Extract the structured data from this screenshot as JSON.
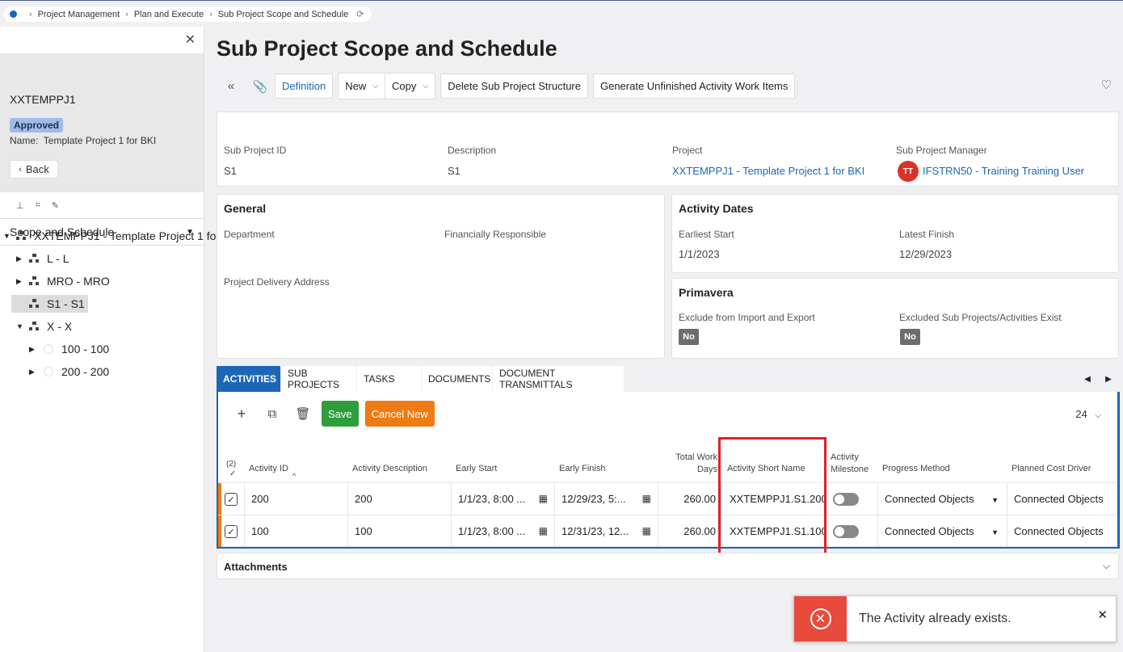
{
  "breadcrumb": {
    "items": [
      "Project Management",
      "Plan and Execute",
      "Sub Project Scope and Schedule"
    ]
  },
  "left": {
    "project_id": "XXTEMPPJ1",
    "status": "Approved",
    "name_label": "Name:",
    "name_value": "Template Project 1 for BKI",
    "back": "Back",
    "scope_select": "Scope and Schedule",
    "tree": [
      "XXTEMPPJ1 - Template Project 1 for",
      "L - L",
      "MRO - MRO",
      "S1 - S1",
      "X - X",
      "100 - 100",
      "200 - 200"
    ]
  },
  "page": {
    "title": "Sub Project Scope and Schedule"
  },
  "toolbar": {
    "definition": "Definition",
    "new": "New",
    "copy": "Copy",
    "delete_structure": "Delete Sub Project Structure",
    "generate": "Generate Unfinished Activity Work Items"
  },
  "header_card": {
    "sub_project_id_label": "Sub Project ID",
    "sub_project_id": "S1",
    "description_label": "Description",
    "description": "S1",
    "project_label": "Project",
    "project": "XXTEMPPJ1 - Template Project 1 for BKI",
    "manager_label": "Sub Project Manager",
    "manager_initials": "TT",
    "manager": "IFSTRN50 - Training Training User"
  },
  "general": {
    "title": "General",
    "department_label": "Department",
    "financially_responsible_label": "Financially Responsible",
    "delivery_address_label": "Project Delivery Address"
  },
  "activity_dates": {
    "title": "Activity Dates",
    "earliest_start_label": "Earliest Start",
    "earliest_start": "1/1/2023",
    "latest_finish_label": "Latest Finish",
    "latest_finish": "12/29/2023"
  },
  "primavera": {
    "title": "Primavera",
    "exclude_label": "Exclude from Import and Export",
    "exclude_value": "No",
    "excluded_exist_label": "Excluded Sub Projects/Activities Exist",
    "excluded_exist_value": "No"
  },
  "tabs": [
    "ACTIVITIES",
    "SUB PROJECTS",
    "TASKS",
    "DOCUMENTS",
    "DOCUMENT TRANSMITTALS"
  ],
  "grid": {
    "save": "Save",
    "cancel_new": "Cancel New",
    "page_size": "24",
    "selected_count": "(2)",
    "columns": [
      "Activity ID",
      "Activity Description",
      "Early Start",
      "Early Finish",
      "Total Work Days",
      "Activity Short Name",
      "Activity Milestone",
      "Progress Method",
      "Planned Cost Driver"
    ],
    "col_total_work_1": "Total Work",
    "col_total_work_2": "Days",
    "col_milestone_1": "Activity",
    "col_milestone_2": "Milestone",
    "rows": [
      {
        "id": "200",
        "desc": "200",
        "start": "1/1/23, 8:00 ...",
        "finish": "12/29/23, 5:...",
        "days": "260.00",
        "short": "XXTEMPPJ1.S1.200",
        "progress": "Connected Objects",
        "driver": "Connected Objects"
      },
      {
        "id": "100",
        "desc": "100",
        "start": "1/1/23, 8:00 ...",
        "finish": "12/31/23, 12...",
        "days": "260.00",
        "short": "XXTEMPPJ1.S1.100",
        "progress": "Connected Objects",
        "driver": "Connected Objects"
      }
    ]
  },
  "attachments": {
    "title": "Attachments"
  },
  "toast": {
    "message": "The Activity already exists."
  },
  "colors": {
    "accent": "#1b67b5",
    "save": "#2e9e3c",
    "cancel": "#ee7b13",
    "error": "#e84a3c",
    "highlight": "#e41e26"
  }
}
